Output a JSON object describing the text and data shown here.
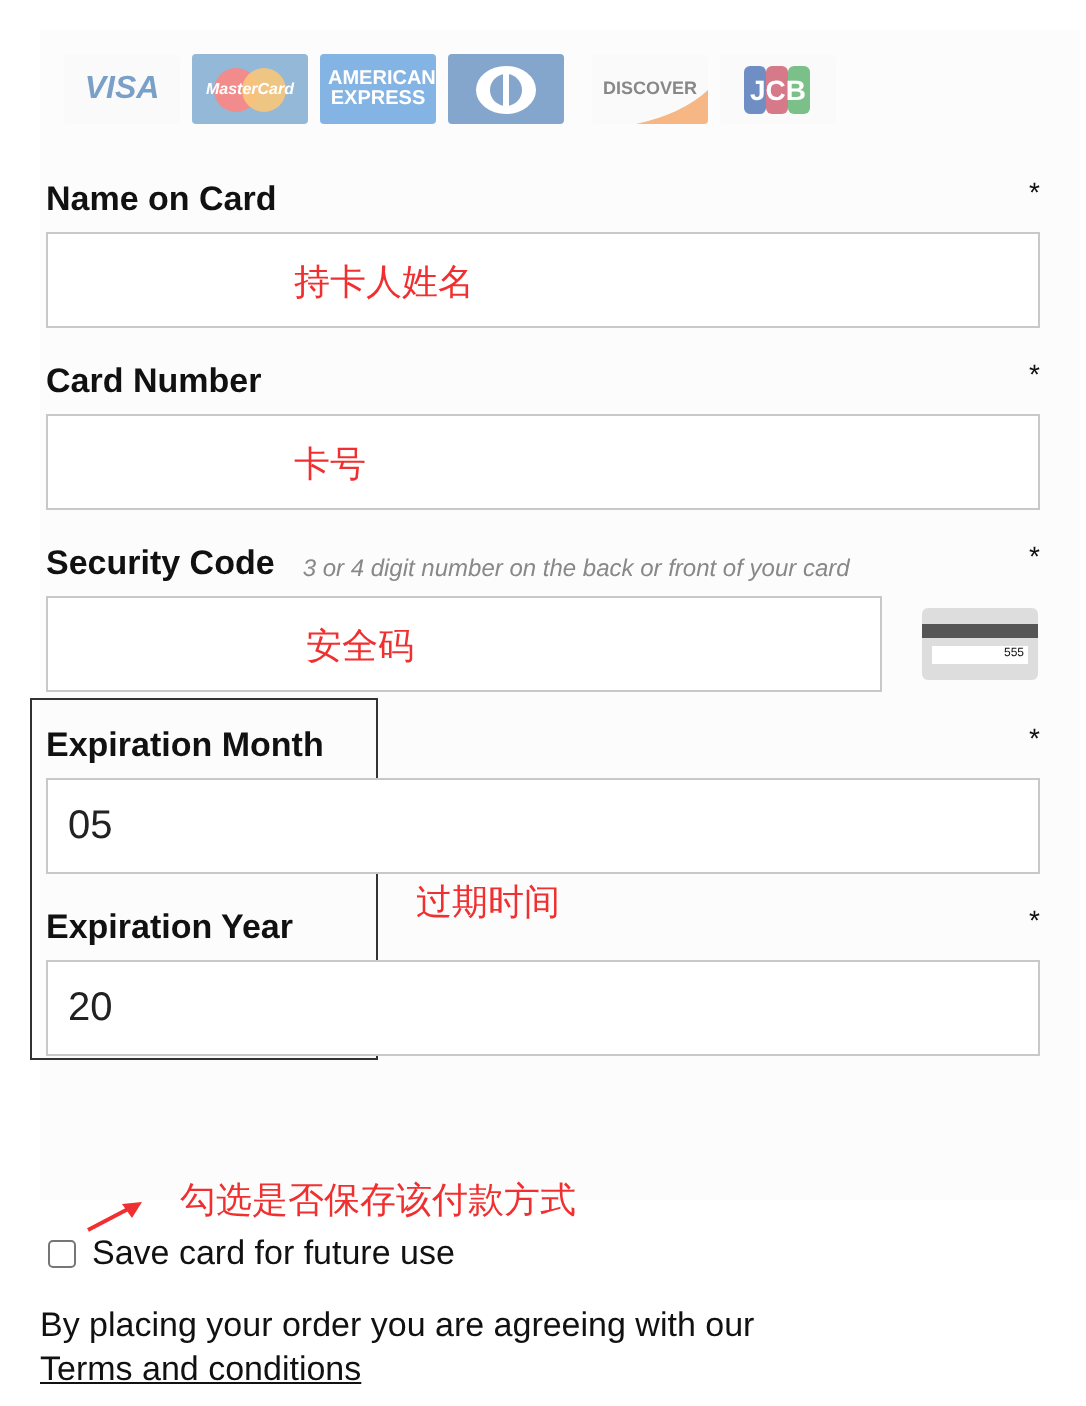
{
  "card_logos": [
    {
      "kind": "visa",
      "text": "VISA"
    },
    {
      "kind": "mastercard",
      "text": "MasterCard"
    },
    {
      "kind": "amex",
      "text": "AMERICAN EXPRESS"
    },
    {
      "kind": "diners"
    },
    {
      "kind": "discover",
      "text": "DISCOVER"
    },
    {
      "kind": "jcb",
      "text": "JCB"
    }
  ],
  "fields": [
    {
      "label": "Name on Card",
      "required_mark": "*",
      "annotation": "持卡人姓名"
    },
    {
      "label": "Card Number",
      "required_mark": "*",
      "annotation": "卡号"
    },
    {
      "label": "Security Code",
      "hint": "3 or 4 digit number on the back or front of your card",
      "required_mark": "*",
      "annotation": "安全码",
      "card_back": {
        "text": "555"
      }
    }
  ],
  "expiration": {
    "annotation": "过期时间",
    "fields": [
      {
        "label": "Expiration Month",
        "required_mark": "*",
        "value": "05"
      },
      {
        "label": "Expiration Year",
        "required_mark": "*",
        "value": "20"
      }
    ]
  },
  "save_note": "勾选是否保存该付款方式",
  "save_card": {
    "label": "Save card for future use",
    "checked": false
  },
  "terms": {
    "text": "By placing your order you are agreeing with our ",
    "link": "Terms and conditions"
  }
}
